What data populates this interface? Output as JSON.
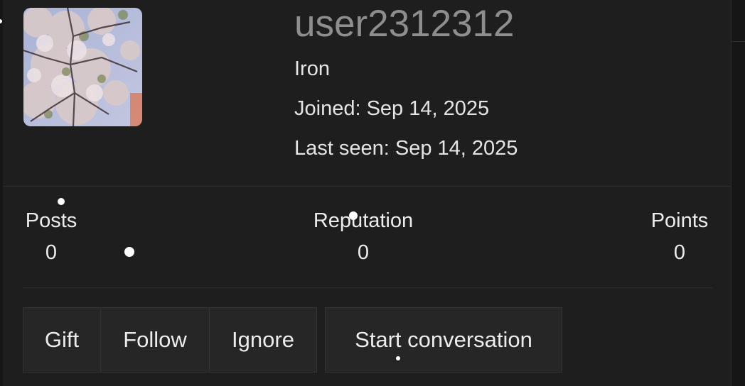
{
  "profile": {
    "username": "user2312312",
    "rank": "Iron",
    "joined_label": "Joined:",
    "joined_value": "Sep 14, 2025",
    "last_seen_label": "Last seen:",
    "last_seen_value": "Sep 14, 2025",
    "avatar_icon": "cherry-blossom-photo"
  },
  "stats": {
    "posts_label": "Posts",
    "posts_value": "0",
    "reputation_label": "Reputation",
    "reputation_value": "0",
    "points_label": "Points",
    "points_value": "0"
  },
  "actions": {
    "gift": "Gift",
    "follow": "Follow",
    "ignore": "Ignore",
    "start_conversation": "Start conversation"
  },
  "colors": {
    "background": "#1e1e1e",
    "username": "#8e8e8e",
    "text": "#e4e4e4",
    "button_bg": "#262626"
  }
}
